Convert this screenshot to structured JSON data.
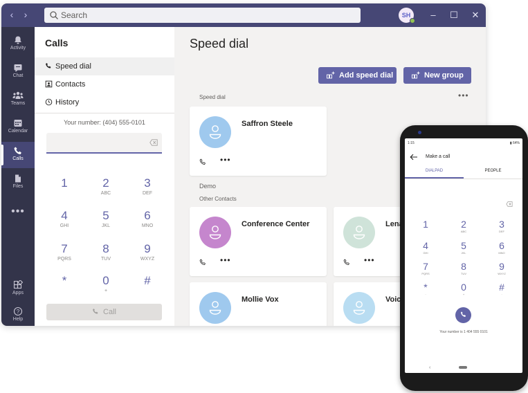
{
  "window": {
    "search_placeholder": "Search",
    "avatar_initials": "SH",
    "nav_back": "‹",
    "nav_forward": "›",
    "minimize": "–",
    "maximize": "☐",
    "close": "✕"
  },
  "rail": {
    "activity": "Activity",
    "chat": "Chat",
    "teams": "Teams",
    "calendar": "Calendar",
    "calls": "Calls",
    "files": "Files",
    "more": "•••",
    "apps": "Apps",
    "help": "Help"
  },
  "calls_pane": {
    "title": "Calls",
    "nav": [
      "Speed dial",
      "Contacts",
      "History"
    ],
    "your_number": "Your number: (404) 555-0101",
    "keys": [
      {
        "d": "1",
        "l": ""
      },
      {
        "d": "2",
        "l": "ABC"
      },
      {
        "d": "3",
        "l": "DEF"
      },
      {
        "d": "4",
        "l": "GHI"
      },
      {
        "d": "5",
        "l": "JKL"
      },
      {
        "d": "6",
        "l": "MNO"
      },
      {
        "d": "7",
        "l": "PQRS"
      },
      {
        "d": "8",
        "l": "TUV"
      },
      {
        "d": "9",
        "l": "WXYZ"
      },
      {
        "d": "*",
        "l": ""
      },
      {
        "d": "0",
        "l": "+"
      },
      {
        "d": "#",
        "l": ""
      }
    ],
    "call_button": "Call"
  },
  "speed_dial": {
    "title": "Speed dial",
    "add_button": "Add speed dial",
    "group_button": "New group",
    "section_label": "Speed dial",
    "more": "•••",
    "demo_label": "Demo",
    "other_label": "Other Contacts",
    "cards": [
      {
        "name": "Saffron Steele",
        "color": "#9fc9ee"
      },
      {
        "name": "Conference Center",
        "color": "#c586cd"
      },
      {
        "name": "Lena",
        "color": "#cfe3d9"
      },
      {
        "name": "Mollie Vox",
        "color": "#9fc9ee"
      },
      {
        "name": "Voic",
        "color": "#b9ddf2"
      }
    ],
    "card_more": "•••"
  },
  "phone": {
    "status_left": "1:15",
    "status_right": "▮ 64%",
    "title": "Make a call",
    "tabs": [
      "DIALPAD",
      "PEOPLE"
    ],
    "keys": [
      {
        "d": "1",
        "l": ""
      },
      {
        "d": "2",
        "l": "ABC"
      },
      {
        "d": "3",
        "l": "DEF"
      },
      {
        "d": "4",
        "l": "GHI"
      },
      {
        "d": "5",
        "l": "JKL"
      },
      {
        "d": "6",
        "l": "MNO"
      },
      {
        "d": "7",
        "l": "PQRS"
      },
      {
        "d": "8",
        "l": "TUV"
      },
      {
        "d": "9",
        "l": "WXYZ"
      },
      {
        "d": "*",
        "l": "·"
      },
      {
        "d": "0",
        "l": "+"
      },
      {
        "d": "#",
        "l": "·"
      }
    ],
    "your_number": "Your number is 1 404 555 0101",
    "nav_back": "‹"
  },
  "colors": {
    "brand": "#6264a7",
    "titlebar": "#464775",
    "rail": "#33344a",
    "presence": "#92c353"
  }
}
